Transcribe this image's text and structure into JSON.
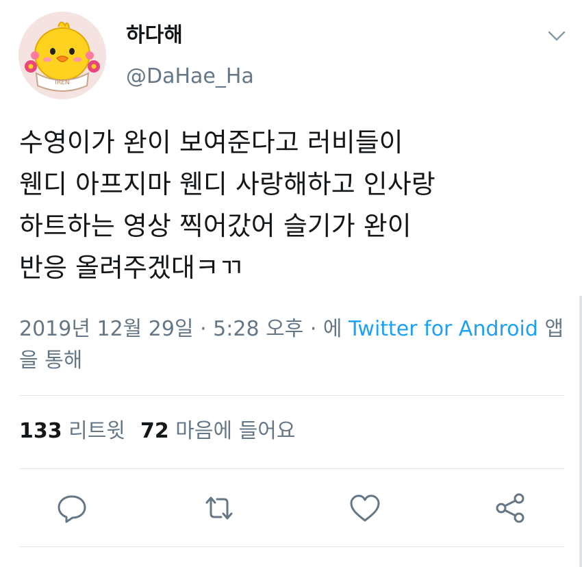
{
  "user": {
    "display_name": "하다해",
    "handle": "@DaHae_Ha",
    "avatar_badge_text": "IREN"
  },
  "tweet": {
    "lines": [
      "수영이가 완이 보여준다고 러비들이",
      "웬디 아프지마 웬디 사랑해하고 인사랑",
      "하트하는 영상 찍어갔어 슬기가 완이",
      "반응 올려주겠대ㅋㄲ"
    ]
  },
  "meta": {
    "timestamp": "2019년 12월 29일 · 5:28 오후 · 에",
    "source": "Twitter for Android",
    "source_suffix": "앱을 통해"
  },
  "stats": {
    "retweets_count": "133",
    "retweets_label": "리트윗",
    "likes_count": "72",
    "likes_label": "마음에 들어요"
  },
  "actions": [
    "reply-icon",
    "retweet-icon",
    "heart-icon",
    "share-icon"
  ],
  "colors": {
    "text": "#14171a",
    "muted": "#657786",
    "link": "#1da1f2",
    "divider": "#e1e8ed"
  }
}
